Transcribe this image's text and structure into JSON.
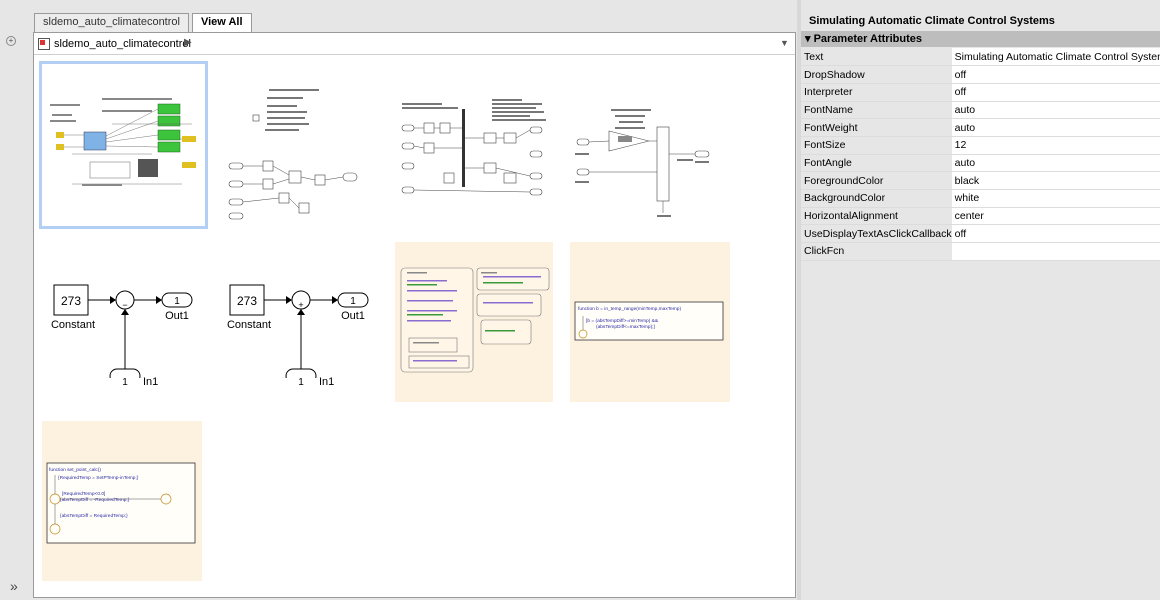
{
  "tabs": [
    "sldemo_auto_climatecontrol",
    "View All"
  ],
  "breadcrumb": "sldemo_auto_climatecontrol",
  "panel": {
    "title": "Simulating Automatic Climate Control Systems",
    "section": "Parameter Attributes",
    "properties": [
      {
        "key": "Text",
        "value": "Simulating Automatic Climate Control Systems"
      },
      {
        "key": "DropShadow",
        "value": "off"
      },
      {
        "key": "Interpreter",
        "value": "off"
      },
      {
        "key": "FontName",
        "value": "auto"
      },
      {
        "key": "FontWeight",
        "value": "auto"
      },
      {
        "key": "FontSize",
        "value": "12"
      },
      {
        "key": "FontAngle",
        "value": "auto"
      },
      {
        "key": "ForegroundColor",
        "value": "black"
      },
      {
        "key": "BackgroundColor",
        "value": "white"
      },
      {
        "key": "HorizontalAlignment",
        "value": "center"
      },
      {
        "key": "UseDisplayTextAsClickCallback",
        "value": "off"
      },
      {
        "key": "ClickFcn",
        "value": ""
      }
    ]
  },
  "diagrams": {
    "const1": {
      "value": "273",
      "label": "Constant",
      "op": "−",
      "out_num": "1",
      "out_label": "Out1",
      "in_num": "1",
      "in_label": "In1"
    },
    "const2": {
      "value": "273",
      "label": "Constant",
      "op": "+",
      "out_num": "1",
      "out_label": "Out1",
      "in_num": "1",
      "in_label": "In1"
    },
    "fn1": {
      "header": "function b = in_temp_range(minTemp,maxTemp)",
      "line1": "[b = (absTempDiff>=minTemp) &&",
      "line2": "(absTempDiff<=maxTemp);]"
    },
    "fn2": {
      "header": "function set_point_calc()",
      "line1": "{RequiredTemp = SetPTemp-inTemp;}",
      "line2": "[RequiredTemp<0.0]",
      "line3": "{absTempDiff = -RequiredTemp;}",
      "line4": "{absTempDiff = RequiredTemp;}"
    }
  }
}
